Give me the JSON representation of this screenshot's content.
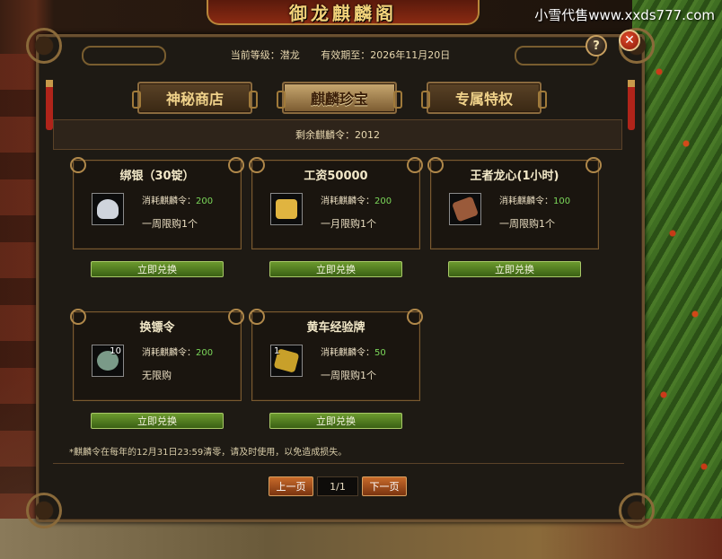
{
  "window": {
    "title": "御龙麒麟阁",
    "watermark": "小雪代售www.xxds777.com"
  },
  "header": {
    "level_label": "当前等级：潜龙",
    "expiry_label": "有效期至：2026年11月20日",
    "help_icon": "question-icon",
    "help_glyph": "?",
    "close_icon": "close-icon",
    "close_glyph": "✕"
  },
  "tabs": [
    {
      "label": "神秘商店",
      "active": false
    },
    {
      "label": "麒麟珍宝",
      "active": true
    },
    {
      "label": "专属特权",
      "active": false
    }
  ],
  "remaining": {
    "label": "剩余麒麟令：2012"
  },
  "items": [
    {
      "name": "绑银（30锭）",
      "icon": "silver-ingot-icon",
      "icon_color": "#cfd4dc",
      "qty": "",
      "cost_prefix": "消耗麒麟令：",
      "cost": "200",
      "limit": "一周限购1个",
      "button": "立即兑换"
    },
    {
      "name": "工资50000",
      "icon": "gold-ingot-icon",
      "icon_color": "#e0b440",
      "qty": "",
      "cost_prefix": "消耗麒麟令：",
      "cost": "200",
      "limit": "一月限购1个",
      "button": "立即兑换"
    },
    {
      "name": "王者龙心(1小时)",
      "icon": "dragon-heart-icon",
      "icon_color": "#9a5a3a",
      "qty": "",
      "cost_prefix": "消耗麒麟令：",
      "cost": "100",
      "limit": "一周限购1个",
      "button": "立即兑换"
    },
    {
      "name": "换镖令",
      "icon": "escort-token-icon",
      "icon_color": "#7a9a88",
      "qty": "10",
      "cost_prefix": "消耗麒麟令：",
      "cost": "200",
      "limit": "无限购",
      "button": "立即兑换"
    },
    {
      "name": "黄车经验牌",
      "icon": "yellow-cart-icon",
      "icon_color": "#c8a02a",
      "qty": "1",
      "cost_prefix": "消耗麒麟令：",
      "cost": "50",
      "limit": "一周限购1个",
      "button": "立即兑换"
    }
  ],
  "notice": "*麒麟令在每年的12月31日23:59清零，请及时使用，以免造成损失。",
  "pager": {
    "prev": "上一页",
    "indicator": "1/1",
    "next": "下一页"
  },
  "colors": {
    "accent_gold": "#f0d28a",
    "cost_green": "#7cd85a",
    "button_green": "#6c9a2e",
    "pager_orange": "#c86a2a"
  }
}
